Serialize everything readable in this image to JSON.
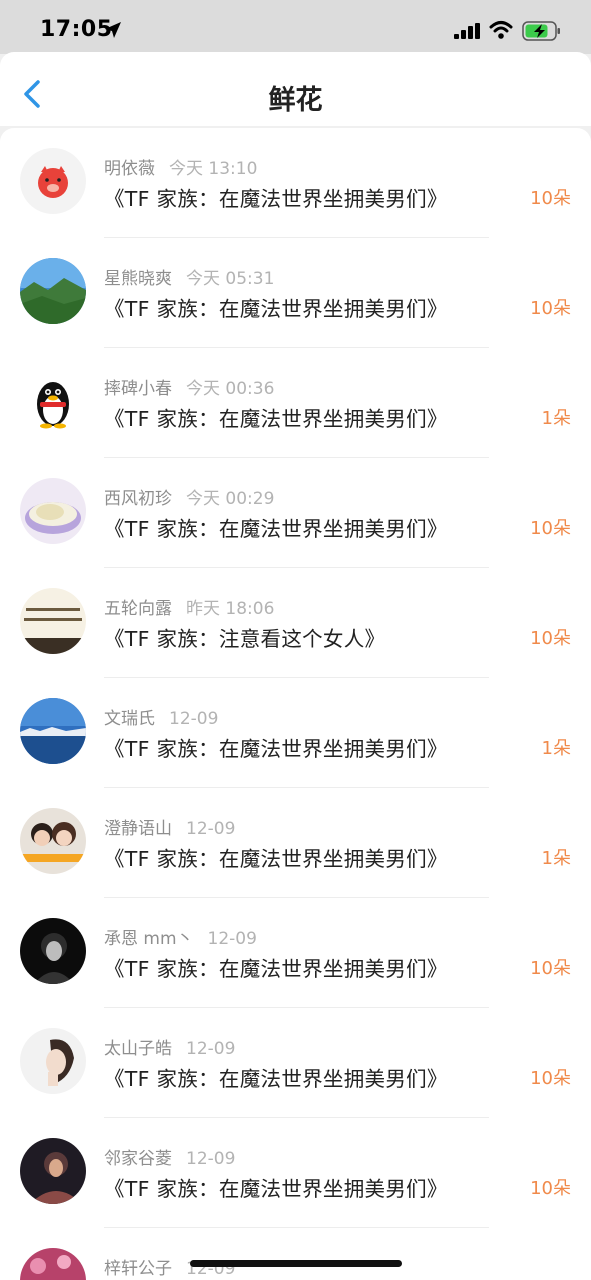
{
  "status": {
    "time": "17:05"
  },
  "nav": {
    "title": "鲜花"
  },
  "items": [
    {
      "name": "明依薇",
      "time": "今天 13:10",
      "book": "《TF 家族：在魔法世界坐拥美男们》",
      "count": "10朵"
    },
    {
      "name": "星熊晓爽",
      "time": "今天 05:31",
      "book": "《TF 家族：在魔法世界坐拥美男们》",
      "count": "10朵"
    },
    {
      "name": "摔碑小春",
      "time": "今天 00:36",
      "book": "《TF 家族：在魔法世界坐拥美男们》",
      "count": "1朵"
    },
    {
      "name": "西风初珍",
      "time": "今天 00:29",
      "book": "《TF 家族：在魔法世界坐拥美男们》",
      "count": "10朵"
    },
    {
      "name": "五轮向露",
      "time": "昨天 18:06",
      "book": "《TF 家族：注意看这个女人》",
      "count": "10朵"
    },
    {
      "name": "文瑞氏",
      "time": "12-09",
      "book": "《TF 家族：在魔法世界坐拥美男们》",
      "count": "1朵"
    },
    {
      "name": "澄静语山",
      "time": "12-09",
      "book": "《TF 家族：在魔法世界坐拥美男们》",
      "count": "1朵"
    },
    {
      "name": "承恩 mm丶",
      "time": "12-09",
      "book": "《TF 家族：在魔法世界坐拥美男们》",
      "count": "10朵"
    },
    {
      "name": "太山子皓",
      "time": "12-09",
      "book": "《TF 家族：在魔法世界坐拥美男们》",
      "count": "10朵"
    },
    {
      "name": "邻家谷菱",
      "time": "12-09",
      "book": "《TF 家族：在魔法世界坐拥美男们》",
      "count": "10朵"
    },
    {
      "name": "梓轩公子",
      "time": "12-09",
      "book": "",
      "count": ""
    }
  ],
  "colors": {
    "accent": "#f08a4b",
    "back": "#2f95e6"
  }
}
